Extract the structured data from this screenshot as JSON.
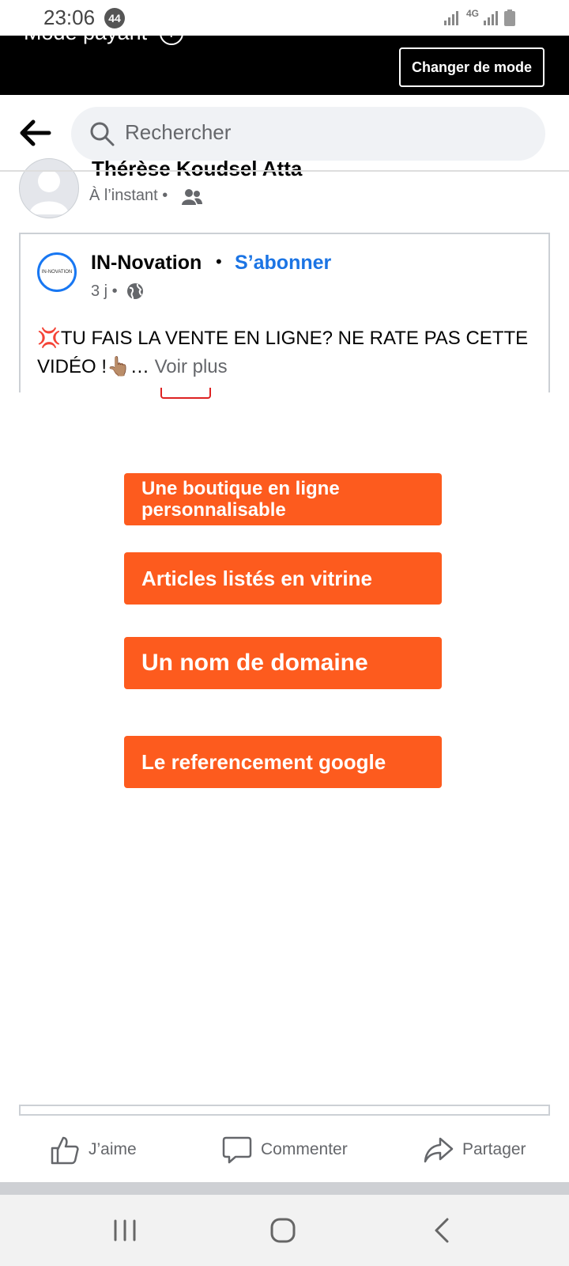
{
  "status_bar": {
    "time": "23:06",
    "notification_count": "44",
    "network": "4G"
  },
  "mode_bar": {
    "title": "Mode payant",
    "button_label": "Changer de mode"
  },
  "search": {
    "placeholder": "Rechercher"
  },
  "previous_post": {
    "author": "Thérèse Koudsel Atta",
    "time": "À l’instant",
    "separator": "•"
  },
  "shared_post": {
    "page_name": "IN-Novation",
    "logo_text": "IN-NOVATION",
    "separator": "•",
    "follow_label": "S’abonner",
    "time": "3 j",
    "text": "💢TU FAIS LA VENTE EN LIGNE? NE RATE PAS CETTE VIDÉO !👆🏽…",
    "see_more": "Voir plus"
  },
  "video": {
    "features": [
      "Une boutique en ligne personnalisable",
      "Articles listés en vitrine",
      "Un nom de domaine",
      "Le referencement google"
    ],
    "overlay_color": "#fd5b1e"
  },
  "actions": {
    "like": "J’aime",
    "comment": "Commenter",
    "share": "Partager"
  }
}
